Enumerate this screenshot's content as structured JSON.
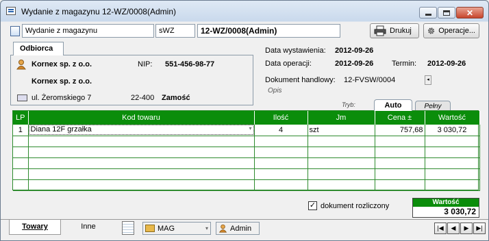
{
  "window": {
    "title": "Wydanie z magazynu 12-WZ/0008(Admin)",
    "close_glyph": "✕"
  },
  "header": {
    "doc_type": "Wydanie z magazynu",
    "series": "sWZ",
    "doc_number": "12-WZ/0008(Admin)",
    "print_label": "Drukuj",
    "operations_label": "Operacje..."
  },
  "odbiorca": {
    "tab_label": "Odbiorca",
    "name": "Kornex sp. z o.o.",
    "name2": "Kornex sp. z o.o.",
    "nip_label": "NIP:",
    "nip": "551-456-98-77",
    "street": "ul. Żeromskiego 7",
    "postcode": "22-400",
    "city": "Zamość"
  },
  "dates": {
    "issue_label": "Data wystawienia:",
    "issue_date": "2012-09-26",
    "operation_label": "Data operacji:",
    "operation_date": "2012-09-26",
    "term_label": "Termin:",
    "term_date": "2012-09-26",
    "trade_doc_label": "Dokument handlowy:",
    "trade_doc": "12-FVSW/0004",
    "opis_label": "Opis"
  },
  "grid_tabs": {
    "tryb": "Tryb:",
    "auto": "Auto",
    "pelny": "Pełny"
  },
  "grid": {
    "columns": [
      "LP",
      "Kod towaru",
      "Ilość",
      "Jm",
      "Cena ±",
      "Wartość"
    ],
    "rows": [
      [
        "1",
        "Diana 12F grzałka",
        "4",
        "szt",
        "757,68",
        "3 030,72"
      ]
    ],
    "empty_rows": 5
  },
  "footer": {
    "settled_label": "dokument rozliczony",
    "settled_checked": true,
    "value_label": "Wartość",
    "value": "3 030,72"
  },
  "bottom": {
    "tab_towary": "Towary",
    "tab_inne": "Inne",
    "warehouse": "MAG",
    "user": "Admin"
  }
}
